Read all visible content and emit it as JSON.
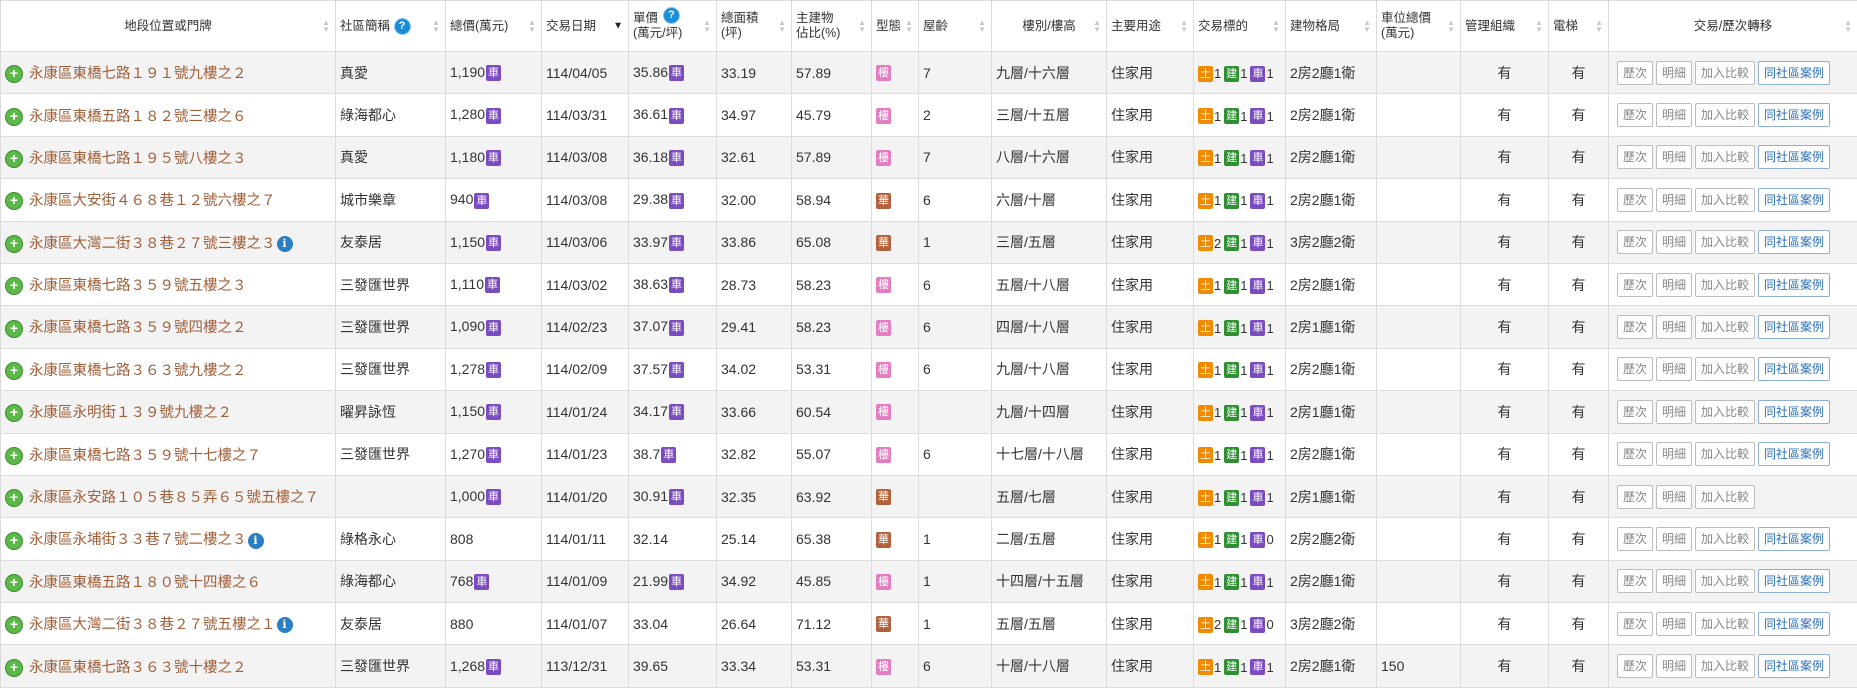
{
  "headers": {
    "address": "地段位置或門牌",
    "community": "社區簡稱",
    "total": "總價(萬元)",
    "date": "交易日期",
    "unit": "單價\n(萬元/坪)",
    "area": "總面積\n(坪)",
    "main_ratio": "主建物\n佔比(%)",
    "type": "型態",
    "age": "屋齡",
    "floor": "樓別/樓高",
    "usage": "主要用途",
    "target": "交易標的",
    "layout": "建物格局",
    "parking": "車位總價\n(萬元)",
    "mgmt": "管理組織",
    "elevator": "電梯",
    "actions": "交易/歷次轉移"
  },
  "help_glyph": "?",
  "icons": {
    "expand": "+",
    "info": "i"
  },
  "tag_labels": {
    "car": "車",
    "land": "土",
    "bld": "建",
    "park": "車",
    "floor": "樓",
    "hua": "華"
  },
  "button_labels": {
    "history": "歷次",
    "detail": "明細",
    "compare": "加入比較",
    "same": "同社區案例"
  },
  "rows": [
    {
      "addr": "永康區東橋七路１９１號九樓之２",
      "info": false,
      "comm": "真愛",
      "total": "1,190",
      "tcar": true,
      "date": "114/04/05",
      "unit": "35.86",
      "ucar": true,
      "area": "33.19",
      "ratio": "57.89",
      "type": "floor",
      "age": "7",
      "floor": "九層/十六層",
      "usage": "住家用",
      "land": "1",
      "bld": "1",
      "park": "1",
      "layout": "2房2廳1衛",
      "pprice": "",
      "mgmt": "有",
      "elev": "有",
      "same": true
    },
    {
      "addr": "永康區東橋五路１８２號三樓之６",
      "info": false,
      "comm": "綠海都心",
      "total": "1,280",
      "tcar": true,
      "date": "114/03/31",
      "unit": "36.61",
      "ucar": true,
      "area": "34.97",
      "ratio": "45.79",
      "type": "floor",
      "age": "2",
      "floor": "三層/十五層",
      "usage": "住家用",
      "land": "1",
      "bld": "1",
      "park": "1",
      "layout": "2房2廳1衛",
      "pprice": "",
      "mgmt": "有",
      "elev": "有",
      "same": true
    },
    {
      "addr": "永康區東橋七路１９５號八樓之３",
      "info": false,
      "comm": "真愛",
      "total": "1,180",
      "tcar": true,
      "date": "114/03/08",
      "unit": "36.18",
      "ucar": true,
      "area": "32.61",
      "ratio": "57.89",
      "type": "floor",
      "age": "7",
      "floor": "八層/十六層",
      "usage": "住家用",
      "land": "1",
      "bld": "1",
      "park": "1",
      "layout": "2房2廳1衛",
      "pprice": "",
      "mgmt": "有",
      "elev": "有",
      "same": true
    },
    {
      "addr": "永康區大安街４６８巷１２號六樓之７",
      "info": false,
      "comm": "城市樂章",
      "total": "940",
      "tcar": true,
      "date": "114/03/08",
      "unit": "29.38",
      "ucar": true,
      "area": "32.00",
      "ratio": "58.94",
      "type": "hua",
      "age": "6",
      "floor": "六層/十層",
      "usage": "住家用",
      "land": "1",
      "bld": "1",
      "park": "1",
      "layout": "2房2廳1衛",
      "pprice": "",
      "mgmt": "有",
      "elev": "有",
      "same": true
    },
    {
      "addr": "永康區大灣二街３８巷２７號三樓之３",
      "info": true,
      "comm": "友泰居",
      "total": "1,150",
      "tcar": true,
      "date": "114/03/06",
      "unit": "33.97",
      "ucar": true,
      "area": "33.86",
      "ratio": "65.08",
      "type": "hua",
      "age": "1",
      "floor": "三層/五層",
      "usage": "住家用",
      "land": "2",
      "bld": "1",
      "park": "1",
      "layout": "3房2廳2衛",
      "pprice": "",
      "mgmt": "有",
      "elev": "有",
      "same": true
    },
    {
      "addr": "永康區東橋七路３５９號五樓之３",
      "info": false,
      "comm": "三發匯世界",
      "total": "1,110",
      "tcar": true,
      "date": "114/03/02",
      "unit": "38.63",
      "ucar": true,
      "area": "28.73",
      "ratio": "58.23",
      "type": "floor",
      "age": "6",
      "floor": "五層/十八層",
      "usage": "住家用",
      "land": "1",
      "bld": "1",
      "park": "1",
      "layout": "2房2廳1衛",
      "pprice": "",
      "mgmt": "有",
      "elev": "有",
      "same": true
    },
    {
      "addr": "永康區東橋七路３５９號四樓之２",
      "info": false,
      "comm": "三發匯世界",
      "total": "1,090",
      "tcar": true,
      "date": "114/02/23",
      "unit": "37.07",
      "ucar": true,
      "area": "29.41",
      "ratio": "58.23",
      "type": "floor",
      "age": "6",
      "floor": "四層/十八層",
      "usage": "住家用",
      "land": "1",
      "bld": "1",
      "park": "1",
      "layout": "2房1廳1衛",
      "pprice": "",
      "mgmt": "有",
      "elev": "有",
      "same": true
    },
    {
      "addr": "永康區東橋七路３６３號九樓之２",
      "info": false,
      "comm": "三發匯世界",
      "total": "1,278",
      "tcar": true,
      "date": "114/02/09",
      "unit": "37.57",
      "ucar": true,
      "area": "34.02",
      "ratio": "53.31",
      "type": "floor",
      "age": "6",
      "floor": "九層/十八層",
      "usage": "住家用",
      "land": "1",
      "bld": "1",
      "park": "1",
      "layout": "2房2廳1衛",
      "pprice": "",
      "mgmt": "有",
      "elev": "有",
      "same": true
    },
    {
      "addr": "永康區永明街１３９號九樓之２",
      "info": false,
      "comm": "曜昇詠恆",
      "total": "1,150",
      "tcar": true,
      "date": "114/01/24",
      "unit": "34.17",
      "ucar": true,
      "area": "33.66",
      "ratio": "60.54",
      "type": "floor",
      "age": "",
      "floor": "九層/十四層",
      "usage": "住家用",
      "land": "1",
      "bld": "1",
      "park": "1",
      "layout": "2房1廳1衛",
      "pprice": "",
      "mgmt": "有",
      "elev": "有",
      "same": true
    },
    {
      "addr": "永康區東橋七路３５９號十七樓之７",
      "info": false,
      "comm": "三發匯世界",
      "total": "1,270",
      "tcar": true,
      "date": "114/01/23",
      "unit": "38.7",
      "ucar": true,
      "area": "32.82",
      "ratio": "55.07",
      "type": "floor",
      "age": "6",
      "floor": "十七層/十八層",
      "usage": "住家用",
      "land": "1",
      "bld": "1",
      "park": "1",
      "layout": "2房2廳1衛",
      "pprice": "",
      "mgmt": "有",
      "elev": "有",
      "same": true
    },
    {
      "addr": "永康區永安路１０５巷８５弄６５號五樓之７",
      "info": false,
      "comm": "",
      "total": "1,000",
      "tcar": true,
      "date": "114/01/20",
      "unit": "30.91",
      "ucar": true,
      "area": "32.35",
      "ratio": "63.92",
      "type": "hua",
      "age": "",
      "floor": "五層/七層",
      "usage": "住家用",
      "land": "1",
      "bld": "1",
      "park": "1",
      "layout": "2房1廳1衛",
      "pprice": "",
      "mgmt": "有",
      "elev": "有",
      "same": false
    },
    {
      "addr": "永康區永埔街３３巷７號二樓之３",
      "info": true,
      "comm": "綠格永心",
      "total": "808",
      "tcar": false,
      "date": "114/01/11",
      "unit": "32.14",
      "ucar": false,
      "area": "25.14",
      "ratio": "65.38",
      "type": "hua",
      "age": "1",
      "floor": "二層/五層",
      "usage": "住家用",
      "land": "1",
      "bld": "1",
      "park": "0",
      "layout": "2房2廳2衛",
      "pprice": "",
      "mgmt": "有",
      "elev": "有",
      "same": true
    },
    {
      "addr": "永康區東橋五路１８０號十四樓之６",
      "info": false,
      "comm": "綠海都心",
      "total": "768",
      "tcar": true,
      "date": "114/01/09",
      "unit": "21.99",
      "ucar": true,
      "area": "34.92",
      "ratio": "45.85",
      "type": "floor",
      "age": "1",
      "floor": "十四層/十五層",
      "usage": "住家用",
      "land": "1",
      "bld": "1",
      "park": "1",
      "layout": "2房2廳1衛",
      "pprice": "",
      "mgmt": "有",
      "elev": "有",
      "same": true
    },
    {
      "addr": "永康區大灣二街３８巷２７號五樓之１",
      "info": true,
      "comm": "友泰居",
      "total": "880",
      "tcar": false,
      "date": "114/01/07",
      "unit": "33.04",
      "ucar": false,
      "area": "26.64",
      "ratio": "71.12",
      "type": "hua",
      "age": "1",
      "floor": "五層/五層",
      "usage": "住家用",
      "land": "2",
      "bld": "1",
      "park": "0",
      "layout": "3房2廳2衛",
      "pprice": "",
      "mgmt": "有",
      "elev": "有",
      "same": true
    },
    {
      "addr": "永康區東橋七路３６３號十樓之２",
      "info": false,
      "comm": "三發匯世界",
      "total": "1,268",
      "tcar": true,
      "date": "113/12/31",
      "unit": "39.65",
      "ucar": false,
      "area": "33.34",
      "ratio": "53.31",
      "type": "floor",
      "age": "6",
      "floor": "十層/十八層",
      "usage": "住家用",
      "land": "1",
      "bld": "1",
      "park": "1",
      "layout": "2房2廳1衛",
      "pprice": "150",
      "mgmt": "有",
      "elev": "有",
      "same": true
    }
  ]
}
